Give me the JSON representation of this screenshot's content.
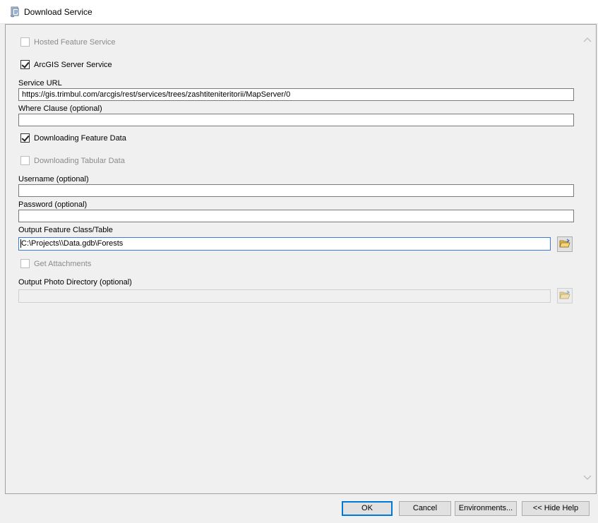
{
  "window": {
    "title": "Download Service",
    "icon": "script-tool-icon"
  },
  "form": {
    "hosted_feature_service": {
      "label": "Hosted Feature Service",
      "checked": false,
      "enabled": false
    },
    "arcgis_server_service": {
      "label": "ArcGIS Server Service",
      "checked": true,
      "enabled": true
    },
    "service_url": {
      "label": "Service URL",
      "value": "https://gis.trimbul.com/arcgis/rest/services/trees/zashtiteniteritorii/MapServer/0"
    },
    "where_clause": {
      "label": "Where Clause (optional)",
      "value": ""
    },
    "downloading_feature_data": {
      "label": "Downloading Feature Data",
      "checked": true,
      "enabled": true
    },
    "downloading_tabular_data": {
      "label": "Downloading Tabular Data",
      "checked": false,
      "enabled": false
    },
    "username": {
      "label": "Username (optional)",
      "value": ""
    },
    "password": {
      "label": "Password (optional)",
      "value": ""
    },
    "output_feature_class": {
      "label": "Output Feature Class/Table",
      "value": "C:\\Projects\\\\Data.gdb\\Forests"
    },
    "get_attachments": {
      "label": "Get Attachments",
      "checked": false,
      "enabled": false
    },
    "output_photo_directory": {
      "label": "Output Photo Directory (optional)",
      "value": ""
    }
  },
  "buttons": {
    "ok": "OK",
    "cancel": "Cancel",
    "environments": "Environments...",
    "hide_help": "<< Hide Help"
  },
  "icons": {
    "browse": "open-folder-icon",
    "scroll_up": "chevron-up-icon",
    "scroll_down": "chevron-down-icon"
  },
  "colors": {
    "focus_border": "#3a7bd5",
    "default_button_border": "#0078d7",
    "panel_bg": "#f0f0f0"
  }
}
